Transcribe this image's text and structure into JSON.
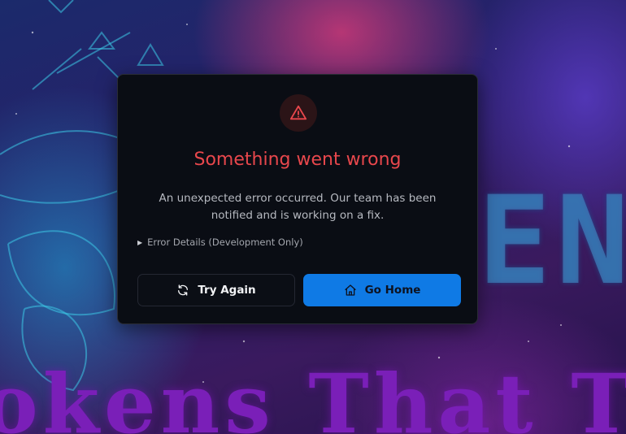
{
  "background": {
    "letters": "EEN",
    "tagline": "okens That T"
  },
  "error_card": {
    "icon": "alert-triangle-icon",
    "title": "Something went wrong",
    "message": "An unexpected error occurred. Our team has been notified and is working on a fix.",
    "details_label": "Error Details (Development Only)",
    "try_again_label": "Try Again",
    "try_again_icon": "refresh-icon",
    "go_home_label": "Go Home",
    "go_home_icon": "home-icon"
  },
  "colors": {
    "accent_red": "#e8474c",
    "primary_blue": "#0f7ae5",
    "card_bg": "#0a0d14"
  }
}
